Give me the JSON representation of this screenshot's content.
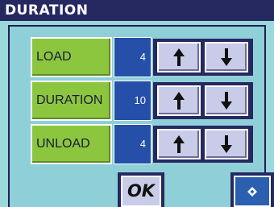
{
  "window": {
    "title": "DURATION"
  },
  "rows": [
    {
      "label": "LOAD",
      "value": "4"
    },
    {
      "label": "DURATION",
      "value": "10"
    },
    {
      "label": "UNLOAD",
      "value": "4"
    }
  ],
  "icons": {
    "up": "arrow-up-icon",
    "down": "arrow-down-icon",
    "nav": "diamond-nav-icon"
  },
  "buttons": {
    "ok_label": "OK"
  },
  "colors": {
    "background": "#9ad8dc",
    "titlebar": "#262860",
    "label_green": "#8cc63f",
    "value_blue": "#254fa8",
    "button_face": "#c8cce8"
  }
}
